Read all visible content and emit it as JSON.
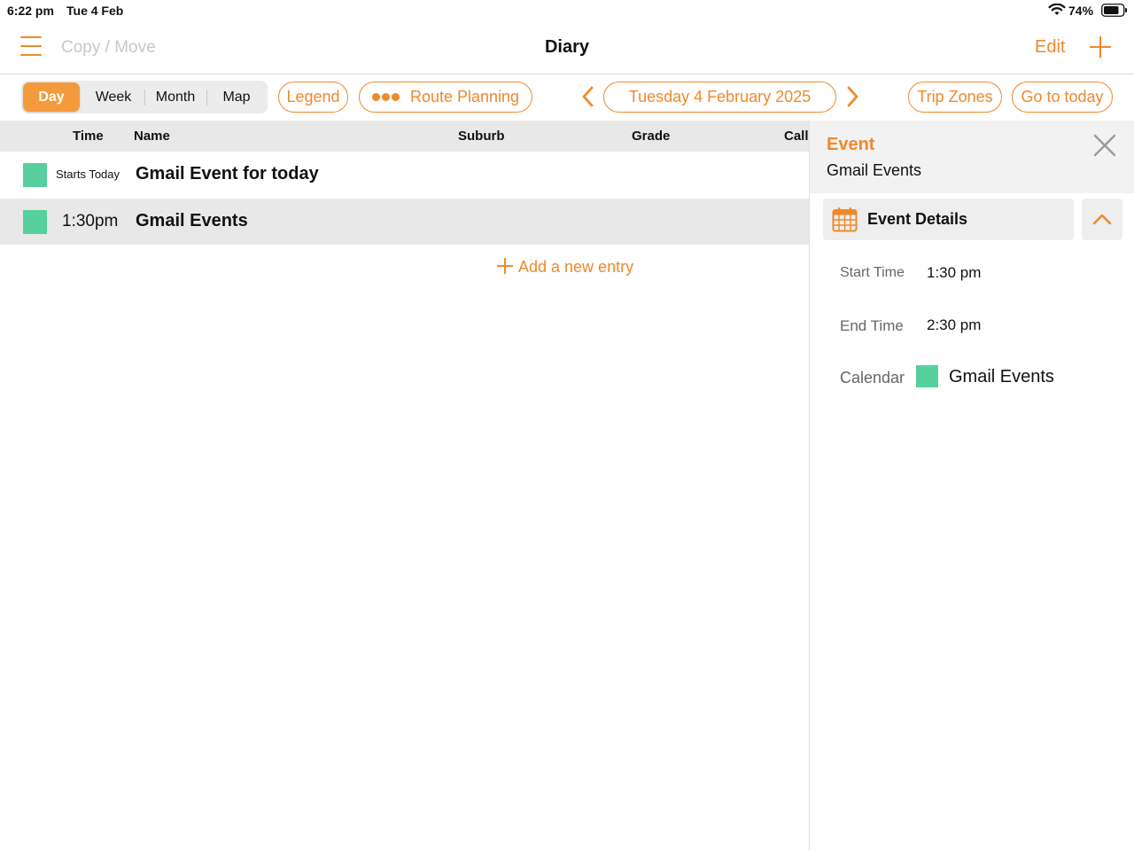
{
  "status_bar": {
    "time": "6:22 pm",
    "date": "Tue 4 Feb",
    "battery": "74%"
  },
  "nav": {
    "copy_move": "Copy / Move",
    "title": "Diary",
    "edit": "Edit"
  },
  "view_tabs": [
    {
      "label": "Day",
      "active": true
    },
    {
      "label": "Week",
      "active": false
    },
    {
      "label": "Month",
      "active": false
    },
    {
      "label": "Map",
      "active": false
    }
  ],
  "toolbar": {
    "legend": "Legend",
    "route_planning": "Route Planning",
    "current_date": "Tuesday 4 February 2025",
    "trip_zones": "Trip Zones",
    "go_to_today": "Go to today"
  },
  "table": {
    "columns": [
      "Time",
      "Name",
      "Suburb",
      "Grade",
      "Call"
    ],
    "rows": [
      {
        "time": "Starts Today",
        "name": "Gmail Event for today",
        "color": "#56d09c",
        "selected": false
      },
      {
        "time": "1:30pm",
        "name": "Gmail Events",
        "color": "#56d09c",
        "selected": true
      }
    ],
    "add_entry": "Add a new entry"
  },
  "detail": {
    "header_title": "Event",
    "header_subtitle": "Gmail Events",
    "section_label": "Event Details",
    "start_label": "Start Time",
    "start_value": "1:30 pm",
    "end_label": "End Time",
    "end_value": "2:30 pm",
    "calendar_label": "Calendar",
    "calendar_value": "Gmail Events",
    "calendar_color": "#56d09c"
  },
  "colors": {
    "accent": "#f0892a",
    "event_green": "#56d09c"
  }
}
